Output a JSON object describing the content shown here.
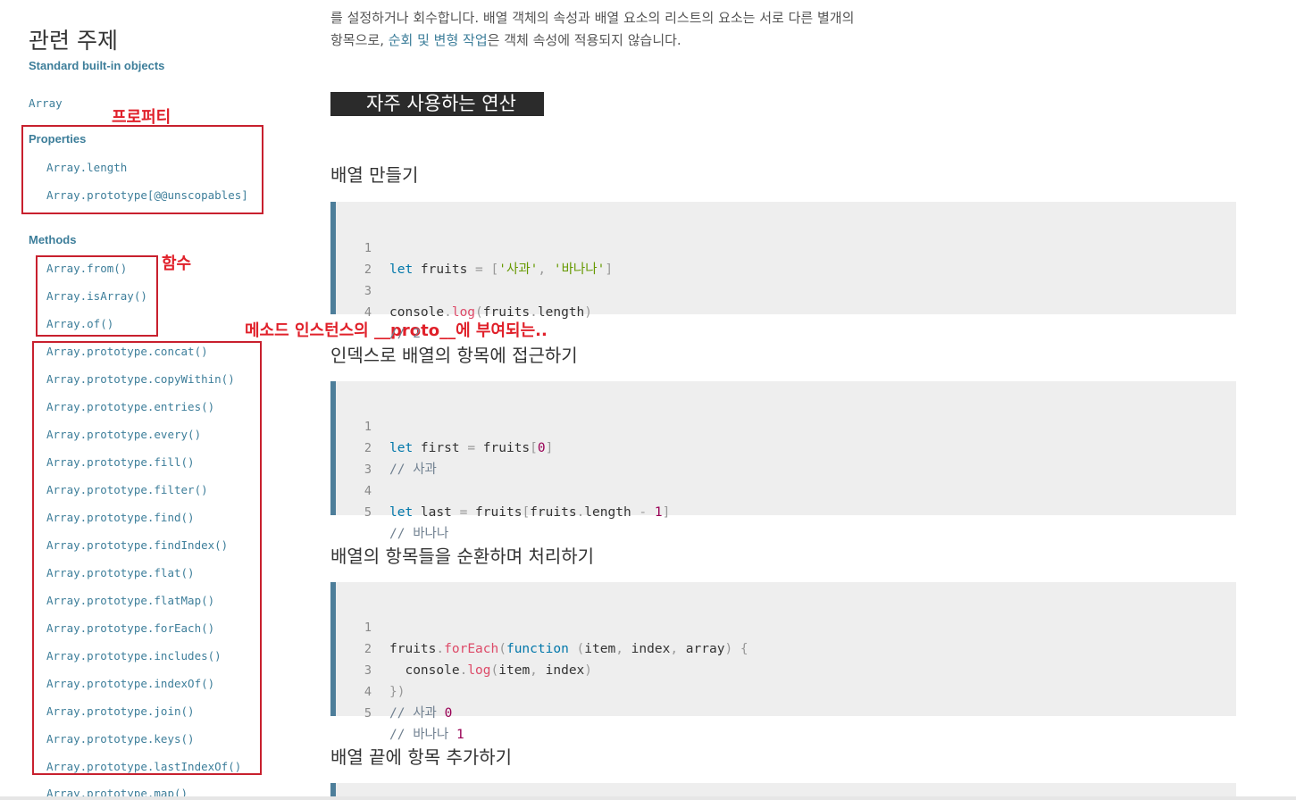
{
  "sidebar": {
    "title": "관련 주제",
    "standard_link": "Standard built-in objects",
    "array_link": "Array",
    "properties_heading": "Properties",
    "properties": [
      "Array.length",
      "Array.prototype[@@unscopables]"
    ],
    "methods_heading": "Methods",
    "static_methods": [
      "Array.from()",
      "Array.isArray()",
      "Array.of()"
    ],
    "proto_methods": [
      "Array.prototype.concat()",
      "Array.prototype.copyWithin()",
      "Array.prototype.entries()",
      "Array.prototype.every()",
      "Array.prototype.fill()",
      "Array.prototype.filter()",
      "Array.prototype.find()",
      "Array.prototype.findIndex()",
      "Array.prototype.flat()",
      "Array.prototype.flatMap()",
      "Array.prototype.forEach()",
      "Array.prototype.includes()",
      "Array.prototype.indexOf()",
      "Array.prototype.join()",
      "Array.prototype.keys()",
      "Array.prototype.lastIndexOf()",
      "Array.prototype.map()"
    ]
  },
  "annotations": {
    "properties": "프로퍼티",
    "functions": "함수",
    "methods": "메소드  인스턴스의 __proto__에 부여되는.."
  },
  "intro": {
    "line1": "를 설정하거나 회수합니다. 배열 객체의 속성과 배열 요소의 리스트의 요소는 서로 다른 별개의",
    "line2_pre": "항목으로, ",
    "line2_link": "순회 및 변형 작업",
    "line2_post": "은 객체 속성에 적용되지 않습니다."
  },
  "main": {
    "section_title": "자주 사용하는 연산",
    "h3_create": "배열 만들기",
    "h3_index": "인덱스로 배열의 항목에 접근하기",
    "h3_loop": "배열의 항목들을 순환하며 처리하기",
    "h3_push": "배열 끝에 항목 추가하기"
  },
  "code": {
    "block1": {
      "l1": {
        "kw": "let",
        "a": " fruits ",
        "op": "=",
        "b": " ",
        "p1": "[",
        "s1": "'사과'",
        "c": ", ",
        "s2": "'바나나'",
        "p2": "]"
      },
      "l3": {
        "a": "console",
        "dot": ".",
        "fn": "log",
        "p1": "(",
        "b": "fruits",
        "dot2": ".",
        "c": "length",
        "p2": ")"
      },
      "l4": "// 2"
    },
    "block2": {
      "l1": {
        "kw": "let",
        "a": " first ",
        "op": "=",
        "b": " fruits",
        "p1": "[",
        "n": "0",
        "p2": "]"
      },
      "l2": "// 사과",
      "l4": {
        "kw": "let",
        "a": " last ",
        "op": "=",
        "b": " fruits",
        "p1": "[",
        "c": "fruits",
        "dot": ".",
        "d": "length ",
        "op2": "-",
        "e": " ",
        "n": "1",
        "p2": "]"
      },
      "l5": "// 바나나"
    },
    "block3": {
      "l1": {
        "a": "fruits",
        "dot": ".",
        "fn": "forEach",
        "p1": "(",
        "kw": "function",
        "b": " ",
        "p2": "(",
        "c": "item",
        "cm1": ", ",
        "d": "index",
        "cm2": ", ",
        "e": "array",
        "p3": ")",
        "f": " ",
        "p4": "{"
      },
      "l2": {
        "a": "  console",
        "dot": ".",
        "fn": "log",
        "p1": "(",
        "b": "item",
        "cm": ", ",
        "c": "index",
        "p2": ")"
      },
      "l3": "})",
      "l4": {
        "cm": "// 사과 ",
        "n": "0"
      },
      "l5": {
        "cm": "// 바나나 ",
        "n": "1"
      }
    }
  }
}
